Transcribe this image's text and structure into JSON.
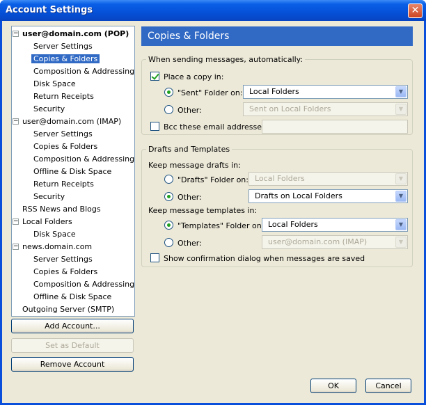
{
  "window": {
    "title": "Account Settings",
    "close_symbol": "✕"
  },
  "tree": {
    "items": [
      {
        "label": "user@domain.com  (POP)",
        "bold": true,
        "level": 0,
        "expander": "−"
      },
      {
        "label": "Server Settings",
        "level": 1
      },
      {
        "label": "Copies & Folders",
        "level": 1,
        "selected": true
      },
      {
        "label": "Composition & Addressing",
        "level": 1
      },
      {
        "label": "Disk Space",
        "level": 1
      },
      {
        "label": "Return Receipts",
        "level": 1
      },
      {
        "label": "Security",
        "level": 1
      },
      {
        "label": "user@domain.com  (IMAP)",
        "level": 0,
        "expander": "−"
      },
      {
        "label": "Server Settings",
        "level": 1
      },
      {
        "label": "Copies & Folders",
        "level": 1
      },
      {
        "label": "Composition & Addressing",
        "level": 1
      },
      {
        "label": "Offline & Disk Space",
        "level": 1
      },
      {
        "label": "Return Receipts",
        "level": 1
      },
      {
        "label": "Security",
        "level": 1
      },
      {
        "label": "RSS News and Blogs",
        "level": 0
      },
      {
        "label": "Local Folders",
        "level": 0,
        "expander": "−"
      },
      {
        "label": "Disk Space",
        "level": 1
      },
      {
        "label": "news.domain.com",
        "level": 0,
        "expander": "−"
      },
      {
        "label": "Server Settings",
        "level": 1
      },
      {
        "label": "Copies & Folders",
        "level": 1
      },
      {
        "label": "Composition & Addressing",
        "level": 1
      },
      {
        "label": "Offline & Disk Space",
        "level": 1
      },
      {
        "label": "Outgoing Server (SMTP)",
        "level": 0
      }
    ]
  },
  "buttons": {
    "add_account": "Add Account...",
    "set_default": "Set as Default",
    "remove_account": "Remove Account",
    "ok": "OK",
    "cancel": "Cancel"
  },
  "panel": {
    "title": "Copies & Folders",
    "sending": {
      "legend": "When sending messages, automatically:",
      "place_copy": {
        "label": "Place a copy in:",
        "checked": true
      },
      "sent_folder": {
        "label": "\"Sent\" Folder on:",
        "selected": true,
        "value": "Local Folders"
      },
      "other": {
        "label": "Other:",
        "selected": false,
        "value": "Sent on Local Folders"
      },
      "bcc": {
        "label": "Bcc these email addresses:",
        "checked": false,
        "value": ""
      }
    },
    "drafts": {
      "legend": "Drafts and Templates",
      "keep_drafts": "Keep message drafts in:",
      "drafts_folder": {
        "label": "\"Drafts\" Folder on:",
        "selected": false,
        "value": "Local Folders"
      },
      "drafts_other": {
        "label": "Other:",
        "selected": true,
        "value": "Drafts on Local Folders"
      },
      "keep_templates": "Keep message templates in:",
      "templates_folder": {
        "label": "\"Templates\" Folder on:",
        "selected": true,
        "value": "Local Folders"
      },
      "templates_other": {
        "label": "Other:",
        "selected": false,
        "value": "user@domain.com  (IMAP)"
      },
      "confirm": {
        "label": "Show confirmation dialog when messages are saved",
        "checked": false
      }
    }
  },
  "icons": {
    "dropdown": "▼",
    "check": "check-icon"
  }
}
